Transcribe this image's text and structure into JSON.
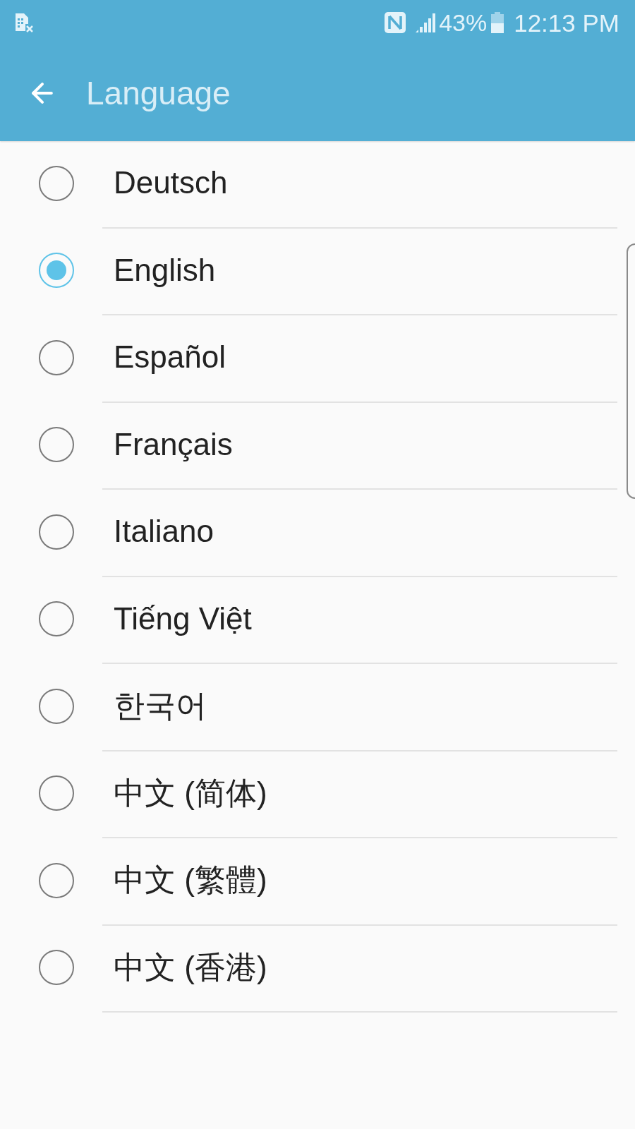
{
  "status_bar": {
    "battery_percent": "43%",
    "time": "12:13 PM"
  },
  "app_bar": {
    "title": "Language"
  },
  "languages": [
    {
      "label": "Deutsch",
      "selected": false
    },
    {
      "label": "English",
      "selected": true
    },
    {
      "label": "Español",
      "selected": false
    },
    {
      "label": "Français",
      "selected": false
    },
    {
      "label": "Italiano",
      "selected": false
    },
    {
      "label": "Tiếng Việt",
      "selected": false
    },
    {
      "label": "한국어",
      "selected": false
    },
    {
      "label": "中文 (简体)",
      "selected": false
    },
    {
      "label": "中文 (繁體)",
      "selected": false
    },
    {
      "label": "中文 (香港)",
      "selected": false
    }
  ]
}
